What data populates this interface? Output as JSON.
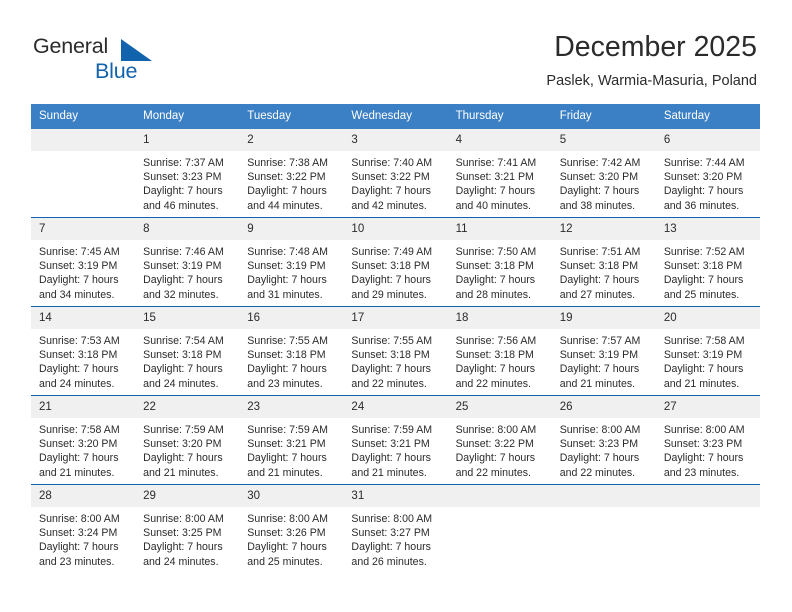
{
  "brand": {
    "word_top": "General",
    "word_bottom": "Blue",
    "accent_color": "#1263ad"
  },
  "header": {
    "title": "December 2025",
    "subtitle": "Paslek, Warmia-Masuria, Poland"
  },
  "calendar": {
    "header_background": "#3b7fc4",
    "daynum_background": "#f0f0f0",
    "row_border_color": "#1263ad",
    "weekdays": [
      "Sunday",
      "Monday",
      "Tuesday",
      "Wednesday",
      "Thursday",
      "Friday",
      "Saturday"
    ],
    "weeks": [
      [
        {
          "day": "",
          "sunrise": "",
          "sunset": "",
          "daylight_a": "",
          "daylight_b": ""
        },
        {
          "day": "1",
          "sunrise": "Sunrise: 7:37 AM",
          "sunset": "Sunset: 3:23 PM",
          "daylight_a": "Daylight: 7 hours",
          "daylight_b": "and 46 minutes."
        },
        {
          "day": "2",
          "sunrise": "Sunrise: 7:38 AM",
          "sunset": "Sunset: 3:22 PM",
          "daylight_a": "Daylight: 7 hours",
          "daylight_b": "and 44 minutes."
        },
        {
          "day": "3",
          "sunrise": "Sunrise: 7:40 AM",
          "sunset": "Sunset: 3:22 PM",
          "daylight_a": "Daylight: 7 hours",
          "daylight_b": "and 42 minutes."
        },
        {
          "day": "4",
          "sunrise": "Sunrise: 7:41 AM",
          "sunset": "Sunset: 3:21 PM",
          "daylight_a": "Daylight: 7 hours",
          "daylight_b": "and 40 minutes."
        },
        {
          "day": "5",
          "sunrise": "Sunrise: 7:42 AM",
          "sunset": "Sunset: 3:20 PM",
          "daylight_a": "Daylight: 7 hours",
          "daylight_b": "and 38 minutes."
        },
        {
          "day": "6",
          "sunrise": "Sunrise: 7:44 AM",
          "sunset": "Sunset: 3:20 PM",
          "daylight_a": "Daylight: 7 hours",
          "daylight_b": "and 36 minutes."
        }
      ],
      [
        {
          "day": "7",
          "sunrise": "Sunrise: 7:45 AM",
          "sunset": "Sunset: 3:19 PM",
          "daylight_a": "Daylight: 7 hours",
          "daylight_b": "and 34 minutes."
        },
        {
          "day": "8",
          "sunrise": "Sunrise: 7:46 AM",
          "sunset": "Sunset: 3:19 PM",
          "daylight_a": "Daylight: 7 hours",
          "daylight_b": "and 32 minutes."
        },
        {
          "day": "9",
          "sunrise": "Sunrise: 7:48 AM",
          "sunset": "Sunset: 3:19 PM",
          "daylight_a": "Daylight: 7 hours",
          "daylight_b": "and 31 minutes."
        },
        {
          "day": "10",
          "sunrise": "Sunrise: 7:49 AM",
          "sunset": "Sunset: 3:18 PM",
          "daylight_a": "Daylight: 7 hours",
          "daylight_b": "and 29 minutes."
        },
        {
          "day": "11",
          "sunrise": "Sunrise: 7:50 AM",
          "sunset": "Sunset: 3:18 PM",
          "daylight_a": "Daylight: 7 hours",
          "daylight_b": "and 28 minutes."
        },
        {
          "day": "12",
          "sunrise": "Sunrise: 7:51 AM",
          "sunset": "Sunset: 3:18 PM",
          "daylight_a": "Daylight: 7 hours",
          "daylight_b": "and 27 minutes."
        },
        {
          "day": "13",
          "sunrise": "Sunrise: 7:52 AM",
          "sunset": "Sunset: 3:18 PM",
          "daylight_a": "Daylight: 7 hours",
          "daylight_b": "and 25 minutes."
        }
      ],
      [
        {
          "day": "14",
          "sunrise": "Sunrise: 7:53 AM",
          "sunset": "Sunset: 3:18 PM",
          "daylight_a": "Daylight: 7 hours",
          "daylight_b": "and 24 minutes."
        },
        {
          "day": "15",
          "sunrise": "Sunrise: 7:54 AM",
          "sunset": "Sunset: 3:18 PM",
          "daylight_a": "Daylight: 7 hours",
          "daylight_b": "and 24 minutes."
        },
        {
          "day": "16",
          "sunrise": "Sunrise: 7:55 AM",
          "sunset": "Sunset: 3:18 PM",
          "daylight_a": "Daylight: 7 hours",
          "daylight_b": "and 23 minutes."
        },
        {
          "day": "17",
          "sunrise": "Sunrise: 7:55 AM",
          "sunset": "Sunset: 3:18 PM",
          "daylight_a": "Daylight: 7 hours",
          "daylight_b": "and 22 minutes."
        },
        {
          "day": "18",
          "sunrise": "Sunrise: 7:56 AM",
          "sunset": "Sunset: 3:18 PM",
          "daylight_a": "Daylight: 7 hours",
          "daylight_b": "and 22 minutes."
        },
        {
          "day": "19",
          "sunrise": "Sunrise: 7:57 AM",
          "sunset": "Sunset: 3:19 PM",
          "daylight_a": "Daylight: 7 hours",
          "daylight_b": "and 21 minutes."
        },
        {
          "day": "20",
          "sunrise": "Sunrise: 7:58 AM",
          "sunset": "Sunset: 3:19 PM",
          "daylight_a": "Daylight: 7 hours",
          "daylight_b": "and 21 minutes."
        }
      ],
      [
        {
          "day": "21",
          "sunrise": "Sunrise: 7:58 AM",
          "sunset": "Sunset: 3:20 PM",
          "daylight_a": "Daylight: 7 hours",
          "daylight_b": "and 21 minutes."
        },
        {
          "day": "22",
          "sunrise": "Sunrise: 7:59 AM",
          "sunset": "Sunset: 3:20 PM",
          "daylight_a": "Daylight: 7 hours",
          "daylight_b": "and 21 minutes."
        },
        {
          "day": "23",
          "sunrise": "Sunrise: 7:59 AM",
          "sunset": "Sunset: 3:21 PM",
          "daylight_a": "Daylight: 7 hours",
          "daylight_b": "and 21 minutes."
        },
        {
          "day": "24",
          "sunrise": "Sunrise: 7:59 AM",
          "sunset": "Sunset: 3:21 PM",
          "daylight_a": "Daylight: 7 hours",
          "daylight_b": "and 21 minutes."
        },
        {
          "day": "25",
          "sunrise": "Sunrise: 8:00 AM",
          "sunset": "Sunset: 3:22 PM",
          "daylight_a": "Daylight: 7 hours",
          "daylight_b": "and 22 minutes."
        },
        {
          "day": "26",
          "sunrise": "Sunrise: 8:00 AM",
          "sunset": "Sunset: 3:23 PM",
          "daylight_a": "Daylight: 7 hours",
          "daylight_b": "and 22 minutes."
        },
        {
          "day": "27",
          "sunrise": "Sunrise: 8:00 AM",
          "sunset": "Sunset: 3:23 PM",
          "daylight_a": "Daylight: 7 hours",
          "daylight_b": "and 23 minutes."
        }
      ],
      [
        {
          "day": "28",
          "sunrise": "Sunrise: 8:00 AM",
          "sunset": "Sunset: 3:24 PM",
          "daylight_a": "Daylight: 7 hours",
          "daylight_b": "and 23 minutes."
        },
        {
          "day": "29",
          "sunrise": "Sunrise: 8:00 AM",
          "sunset": "Sunset: 3:25 PM",
          "daylight_a": "Daylight: 7 hours",
          "daylight_b": "and 24 minutes."
        },
        {
          "day": "30",
          "sunrise": "Sunrise: 8:00 AM",
          "sunset": "Sunset: 3:26 PM",
          "daylight_a": "Daylight: 7 hours",
          "daylight_b": "and 25 minutes."
        },
        {
          "day": "31",
          "sunrise": "Sunrise: 8:00 AM",
          "sunset": "Sunset: 3:27 PM",
          "daylight_a": "Daylight: 7 hours",
          "daylight_b": "and 26 minutes."
        },
        {
          "day": "",
          "sunrise": "",
          "sunset": "",
          "daylight_a": "",
          "daylight_b": ""
        },
        {
          "day": "",
          "sunrise": "",
          "sunset": "",
          "daylight_a": "",
          "daylight_b": ""
        },
        {
          "day": "",
          "sunrise": "",
          "sunset": "",
          "daylight_a": "",
          "daylight_b": ""
        }
      ]
    ]
  }
}
